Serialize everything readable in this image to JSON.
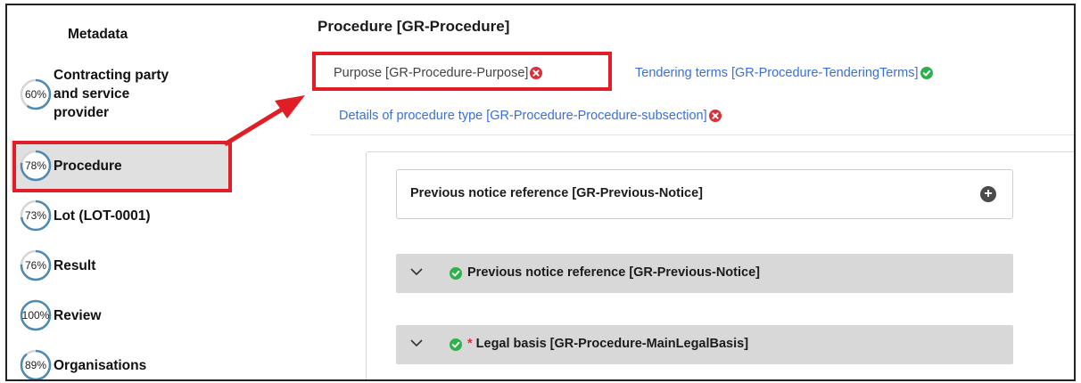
{
  "sidebar": {
    "metadata_label": "Metadata",
    "items": [
      {
        "pct": "60%",
        "progress": 0.6,
        "label_lines": [
          "Contracting party",
          "and service",
          "provider"
        ]
      },
      {
        "pct": "78%",
        "progress": 0.78,
        "label": "Procedure",
        "active": true
      },
      {
        "pct": "73%",
        "progress": 0.73,
        "label": "Lot (LOT-0001)"
      },
      {
        "pct": "76%",
        "progress": 0.76,
        "label": "Result"
      },
      {
        "pct": "100%",
        "progress": 1.0,
        "label": "Review"
      },
      {
        "pct": "89%",
        "progress": 0.89,
        "label": "Organisations"
      }
    ]
  },
  "main": {
    "title": "Procedure [GR-Procedure]",
    "tabs": [
      {
        "label": "Purpose  [GR-Procedure-Purpose]",
        "status": "error",
        "current": true
      },
      {
        "label": "Tendering terms  [GR-Procedure-TenderingTerms]",
        "status": "ok"
      },
      {
        "label": "Details of procedure type  [GR-Procedure-Procedure-subsection]",
        "status": "error"
      }
    ],
    "notice_box": {
      "title": "Previous notice reference  [GR-Previous-Notice]"
    },
    "accordions": [
      {
        "title": "Previous notice reference  [GR-Previous-Notice]",
        "status": "ok",
        "required": false
      },
      {
        "title": "Legal basis  [GR-Procedure-MainLegalBasis]",
        "status": "ok",
        "required": true,
        "required_mark": "*"
      }
    ]
  },
  "colors": {
    "link": "#3b6fd8",
    "ok": "#2fb14a",
    "error": "#d9303a",
    "highlight": "#e01e26",
    "ring_track": "#d6d6d6",
    "ring_fill": "#4f8bb0"
  }
}
